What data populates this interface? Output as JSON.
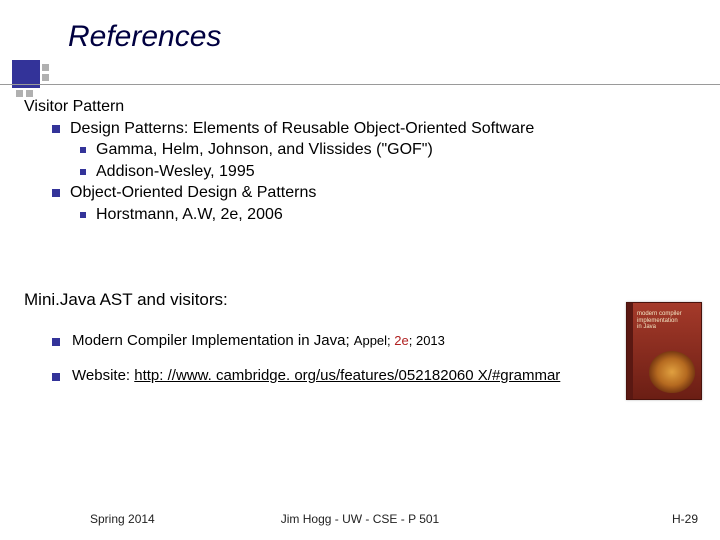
{
  "title": "References",
  "section1": {
    "heading": "Visitor Pattern",
    "items": [
      {
        "label": "Design Patterns: Elements of Reusable Object-Oriented Software",
        "sub": [
          "Gamma, Helm, Johnson, and Vlissides (\"GOF\")",
          "Addison-Wesley, 1995"
        ]
      },
      {
        "label": "Object-Oriented Design & Patterns",
        "sub": [
          "Horstmann, A.W, 2e, 2006"
        ]
      }
    ]
  },
  "section2": {
    "heading": "Mini.Java AST and visitors:",
    "items": [
      {
        "prefix": "Modern Compiler Implementation in Java; ",
        "author": "Appel; ",
        "edition": "2e",
        "suffix": "; 2013"
      },
      {
        "prefix": "Website: ",
        "link": "http: //www. cambridge. org/us/features/052182060 X/#grammar"
      }
    ]
  },
  "book_cover": {
    "title_line1": "modern compiler",
    "title_line2": "implementation",
    "title_line3": "in Java"
  },
  "footer": {
    "left": "Spring 2014",
    "center": "Jim Hogg - UW - CSE - P 501",
    "right": "H-29"
  }
}
